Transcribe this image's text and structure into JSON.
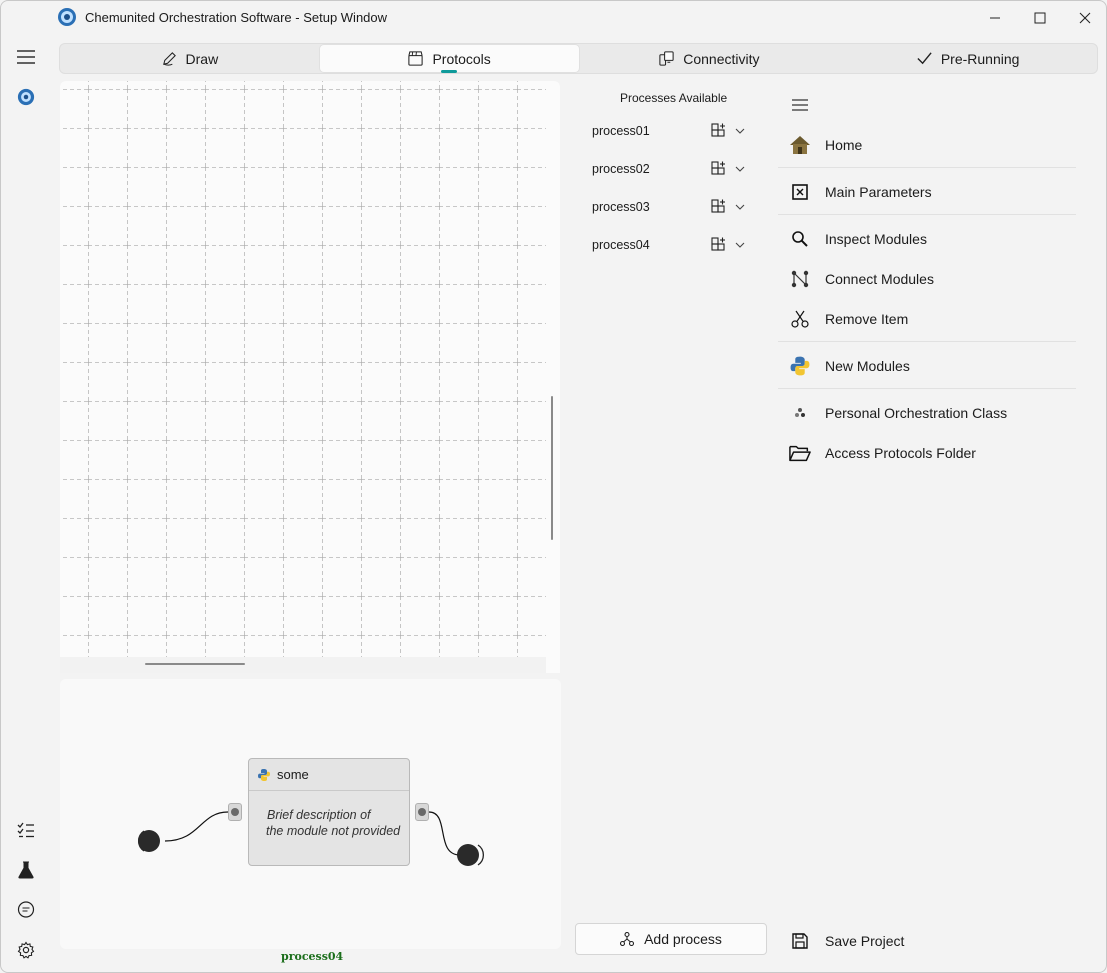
{
  "window": {
    "title": "Chemunited Orchestration Software - Setup Window"
  },
  "tabs": [
    {
      "label": "Draw",
      "icon": "pencil-icon",
      "active": false
    },
    {
      "label": "Protocols",
      "icon": "clapperboard-icon",
      "active": true
    },
    {
      "label": "Connectivity",
      "icon": "devices-icon",
      "active": false
    },
    {
      "label": "Pre-Running",
      "icon": "checkmark-icon",
      "active": false
    }
  ],
  "processes": {
    "title": "Processes Available",
    "items": [
      "process01",
      "process02",
      "process03",
      "process04"
    ]
  },
  "menu": {
    "items": [
      {
        "label": "Home",
        "icon": "home-icon"
      },
      {
        "label": "Main Parameters",
        "icon": "variable-icon"
      },
      {
        "label": "Inspect Modules",
        "icon": "search-icon"
      },
      {
        "label": "Connect Modules",
        "icon": "connect-icon"
      },
      {
        "label": "Remove Item",
        "icon": "scissors-icon"
      },
      {
        "label": "New Modules",
        "icon": "python-icon"
      },
      {
        "label": "Personal Orchestration Class",
        "icon": "class-icon"
      },
      {
        "label": "Access Protocols Folder",
        "icon": "folder-open-icon"
      }
    ],
    "save_label": "Save Project"
  },
  "protocol_canvas": {
    "node_title": "some",
    "node_description_line1": "Brief description of",
    "node_description_line2": "the module not provided",
    "process_label": "process04"
  },
  "actions": {
    "add_process_label": "Add process"
  },
  "colors": {
    "accent": "#0f9a9a",
    "process_label": "#1b6e1b",
    "home_icon": "#6b5a2e"
  }
}
